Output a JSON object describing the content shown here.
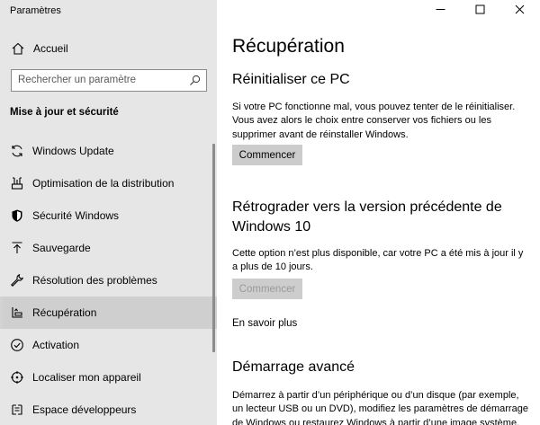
{
  "window": {
    "app_title": "Paramètres"
  },
  "sidebar": {
    "home_label": "Accueil",
    "search_placeholder": "Rechercher un paramètre",
    "section_title": "Mise à jour et sécurité",
    "items": [
      {
        "label": "Windows Update",
        "icon": "sync-icon"
      },
      {
        "label": "Optimisation de la distribution",
        "icon": "delivery-optimization-icon"
      },
      {
        "label": "Sécurité Windows",
        "icon": "shield-icon"
      },
      {
        "label": "Sauvegarde",
        "icon": "backup-icon"
      },
      {
        "label": "Résolution des problèmes",
        "icon": "wrench-icon"
      },
      {
        "label": "Récupération",
        "icon": "recovery-icon",
        "selected": true
      },
      {
        "label": "Activation",
        "icon": "activation-check-icon"
      },
      {
        "label": "Localiser mon appareil",
        "icon": "find-device-icon"
      },
      {
        "label": "Espace développeurs",
        "icon": "developer-icon"
      }
    ]
  },
  "main": {
    "title": "Récupération",
    "reset": {
      "heading": "Réinitialiser ce PC",
      "description": "Si votre PC fonctionne mal, vous pouvez tenter de le réinitialiser. Vous avez alors le choix entre conserver vos fichiers ou les supprimer avant de réinstaller Windows.",
      "button": "Commencer"
    },
    "rollback": {
      "heading": "Rétrograder vers la version précédente de Windows 10",
      "description": "Cette option n’est plus disponible, car votre PC a été mis à jour il y a plus de 10 jours.",
      "button": "Commencer",
      "link": "En savoir plus"
    },
    "advanced": {
      "heading": "Démarrage avancé",
      "description": "Démarrez à partir d’un périphérique ou d’un disque (par exemple, un lecteur USB ou un DVD), modifiez les paramètres de démarrage de Windows ou restaurez Windows à partir d’une image système. Votre"
    }
  },
  "colors": {
    "sidebar_bg": "#e6e6e6",
    "selected_bg": "#cfcfcf",
    "button_bg": "#cccccc"
  }
}
